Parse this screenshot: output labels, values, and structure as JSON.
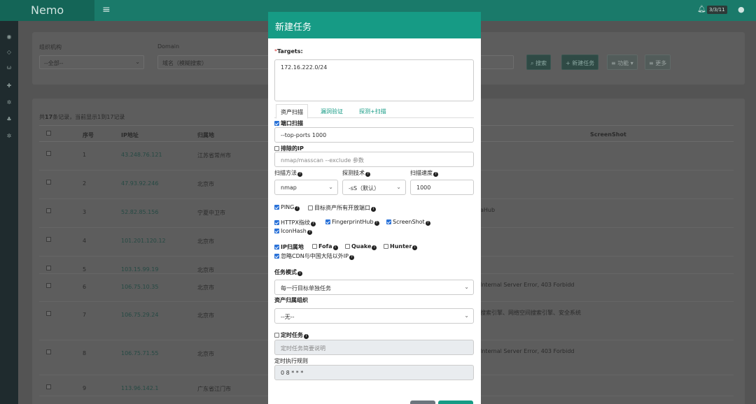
{
  "topbar": {
    "brand": "Nemo",
    "menu_icon": "hamburger-icon",
    "notif_icon": "bell-icon",
    "badge": "3/3/11",
    "user_icon": "user-icon"
  },
  "sidebar_icons": [
    "dashboard-icon",
    "share-icon",
    "web-icon",
    "plus-icon",
    "gear-icon",
    "users-icon",
    "settings-icon"
  ],
  "filters": {
    "org_label": "组织机构",
    "org_value": "--全部--",
    "domain_label": "Domain",
    "domain_placeholder": "域名（模糊搜索）",
    "search_btn": "搜索",
    "new_task_btn": "新建任务",
    "functions_btn": "功能",
    "more_btn": "更多"
  },
  "table": {
    "summary_pre": "共",
    "summary_count": "17",
    "summary_mid": "条记录，当前显示1到",
    "summary_to": "17",
    "summary_post": "记录",
    "headers": {
      "index": "序号",
      "ip": "IP地址",
      "location": "归属地",
      "screenshot": "ScreenShot"
    },
    "rows": [
      {
        "index": "1",
        "ip": "43.248.76.121",
        "location": "江苏省常州市",
        "extra": ""
      },
      {
        "index": "2",
        "ip": "47.93.92.246",
        "location": "北京市",
        "extra": ""
      },
      {
        "index": "3",
        "ip": "52.82.85.156",
        "location": "宁夏中卫市",
        "extra": "aHub"
      },
      {
        "index": "4",
        "ip": "101.201.120.12",
        "location": "北京市",
        "extra": ""
      },
      {
        "index": "5",
        "ip": "103.15.99.19",
        "location": "北京市",
        "extra": ""
      },
      {
        "index": "6",
        "ip": "106.75.10.35",
        "location": "北京市",
        "extra": "Internal Server Error, 403 Forbidd"
      },
      {
        "index": "7",
        "ip": "106.75.29.24",
        "location": "北京市",
        "extra": "搜索引擎、网络空间搜索引擎、安全系统"
      },
      {
        "index": "8",
        "ip": "106.75.71.55",
        "location": "北京市",
        "extra": "Internal Server Error, 403 Forbidd"
      },
      {
        "index": "9",
        "ip": "113.96.142.1",
        "location": "广东省江门市",
        "extra": ""
      }
    ]
  },
  "modal": {
    "title": "新建任务",
    "targets_label": "Targets:",
    "targets_value": "172.16.222.0/24",
    "tabs": [
      "资产扫描",
      "漏洞验证",
      "探测+扫描"
    ],
    "port_scan_label": "端口扫描",
    "port_scan_value": "--top-ports 1000",
    "exclude_ip_label": "排除的IP",
    "exclude_ip_placeholder": "nmap/masscan --exclude 参数",
    "scan_method_label": "扫描方法",
    "scan_method_value": "nmap",
    "probe_tech_label": "探测技术",
    "probe_tech_value": "-sS（默认）",
    "scan_speed_label": "扫描速度",
    "scan_speed_value": "1000",
    "ping_label": "PING",
    "all_ports_label": "目标资产所有开放端口",
    "httpx_label": "HTTPX指纹",
    "fingerprinthub_label": "FingerprintHub",
    "screenshot_label": "ScreenShot",
    "iconhash_label": "IconHash",
    "ip_location_label": "IP归属地",
    "fofa_label": "Fofa",
    "quake_label": "Quake",
    "hunter_label": "Hunter",
    "ignore_cdn_label": "忽略CDN与中国大陆以外IP",
    "task_mode_label": "任务模式",
    "task_mode_value": "每一行目标单独任务",
    "asset_org_label": "资产归属组织",
    "asset_org_value": "--无--",
    "scheduled_label": "定时任务",
    "scheduled_placeholder": "定时任务简要说明",
    "cron_label": "定时执行规则",
    "cron_value": "0 8 * * *"
  }
}
